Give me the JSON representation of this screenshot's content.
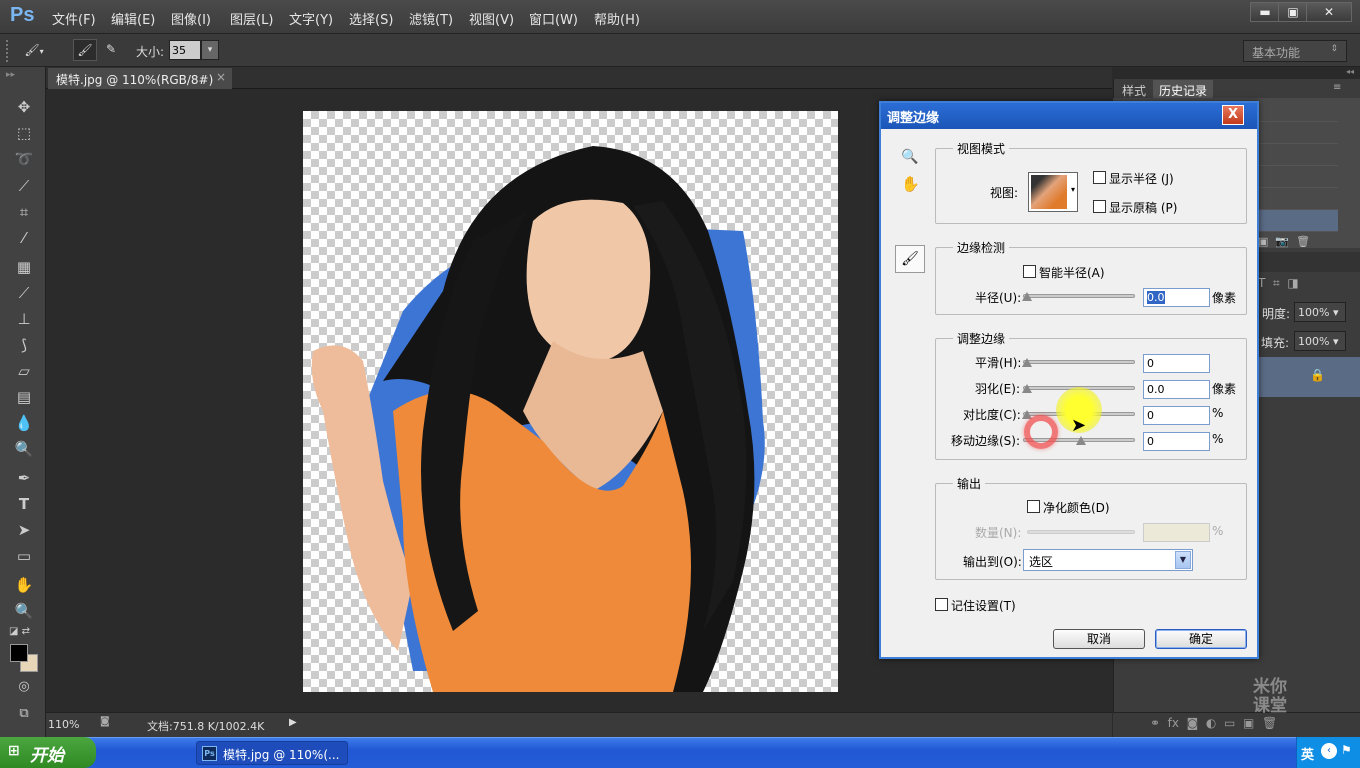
{
  "app": {
    "logo": "Ps"
  },
  "menu": [
    "文件(F)",
    "编辑(E)",
    "图像(I)",
    "图层(L)",
    "文字(Y)",
    "选择(S)",
    "滤镜(T)",
    "视图(V)",
    "窗口(W)",
    "帮助(H)"
  ],
  "window_controls": {
    "minimize": "▬",
    "maximize": "▣",
    "close": "✕"
  },
  "options_bar": {
    "size_label": "大小:",
    "size_value": "35",
    "workspace": "基本功能"
  },
  "document": {
    "tab_title": "模特.jpg @ 110%(RGB/8#)",
    "tab_close": "×"
  },
  "status": {
    "zoom": "110%",
    "doc_info": "文档:751.8 K/1002.4K"
  },
  "right_panel": {
    "tabs": [
      "样式",
      "历史记录"
    ],
    "opacity_label": "明度:",
    "opacity_value": "100%",
    "fill_label": "填充:",
    "fill_value": "100%"
  },
  "dialog": {
    "title": "调整边缘",
    "close": "X",
    "view_mode": {
      "title": "视图模式",
      "view_label": "视图:",
      "show_radius": "显示半径 (J)",
      "show_original": "显示原稿 (P)"
    },
    "edge_detection": {
      "title": "边缘检测",
      "smart_radius": "智能半径(A)",
      "radius_label": "半径(U):",
      "radius_value": "0.0",
      "radius_unit": "像素"
    },
    "adjust_edge": {
      "title": "调整边缘",
      "smooth_label": "平滑(H):",
      "smooth_value": "0",
      "feather_label": "羽化(E):",
      "feather_value": "0.0",
      "feather_unit": "像素",
      "contrast_label": "对比度(C):",
      "contrast_value": "0",
      "contrast_unit": "%",
      "shift_label": "移动边缘(S):",
      "shift_value": "0",
      "shift_unit": "%"
    },
    "output": {
      "title": "输出",
      "decontaminate": "净化颜色(D)",
      "amount_label": "数量(N):",
      "amount_unit": "%",
      "output_to_label": "输出到(O):",
      "output_to_value": "选区"
    },
    "remember": "记住设置(T)",
    "cancel": "取消",
    "ok": "确定"
  },
  "taskbar": {
    "start": "开始",
    "task_item": "模特.jpg @ 110%(...",
    "tray_lang": "英"
  },
  "watermark": [
    "米你",
    "课堂"
  ]
}
